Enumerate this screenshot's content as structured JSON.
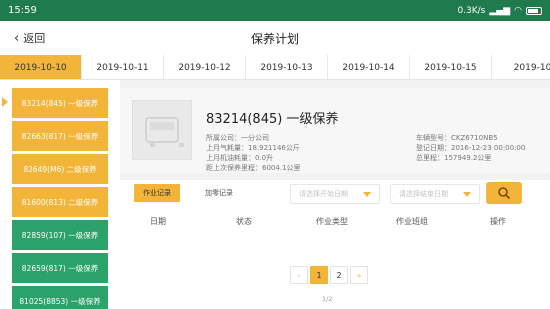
{
  "statusbar": {
    "time": "15:59",
    "net_speed": "0.3K/s"
  },
  "header": {
    "back_label": "返回",
    "title": "保养计划"
  },
  "dates": [
    "2019-10-10",
    "2019-10-11",
    "2019-10-12",
    "2019-10-13",
    "2019-10-14",
    "2019-10-15",
    "2019-10"
  ],
  "sidebar": {
    "items": [
      {
        "label": "83214(845)  一级保养",
        "color": "orange"
      },
      {
        "label": "82663(817)  一级保养",
        "color": "orange"
      },
      {
        "label": "82649(M6)  二级保养",
        "color": "orange"
      },
      {
        "label": "81600(813)  二级保养",
        "color": "orange"
      },
      {
        "label": "82859(107)  一级保养",
        "color": "green"
      },
      {
        "label": "82659(817)  一级保养",
        "color": "green"
      },
      {
        "label": "81025(8853)  一级保养",
        "color": "green"
      }
    ]
  },
  "vehicle": {
    "title": "83214(845)  一级保养",
    "company": "所属公司：一分公司",
    "last_month_gas": "上月气耗量：18.921146公斤",
    "last_month_oil": "上月机油耗量：0.0升",
    "since_last_maint": "距上次保养里程：6004.1公里",
    "model": "车辆型号：CKZ6710NB5",
    "reg_date": "登记日期：2016-12-23 00:00:00",
    "mileage": "总里程：157949.2公里"
  },
  "records": {
    "tab_work": "作业记录",
    "tab_lube": "加零记录",
    "start_placeholder": "请选择开始日期",
    "end_placeholder": "请选择结束日期",
    "columns": [
      "日期",
      "状态",
      "作业类型",
      "作业班组",
      "操作"
    ],
    "pager": {
      "prev": "«",
      "page1": "1",
      "page2": "2",
      "next": "»",
      "count": "1/2"
    }
  },
  "colors": {
    "accent": "#f3b43a",
    "green": "#2ba26a",
    "statusbar": "#1f7a4d"
  }
}
